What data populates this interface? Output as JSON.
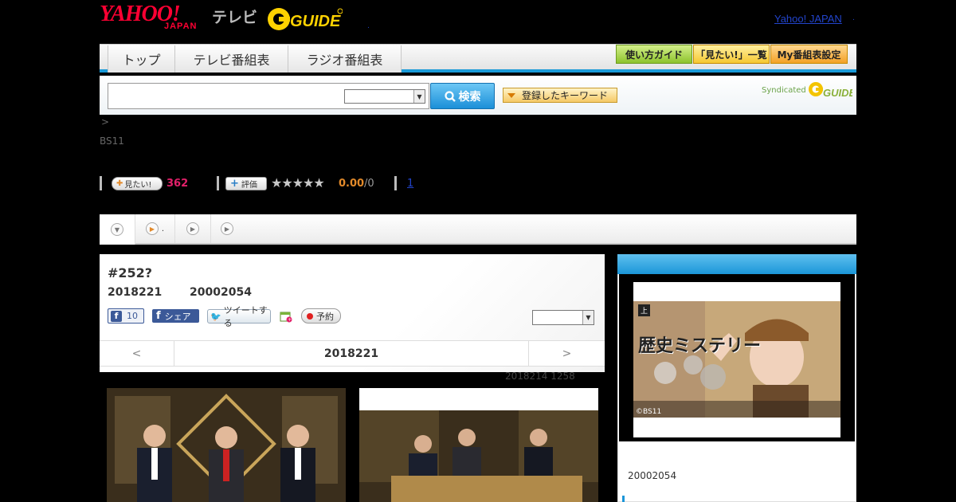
{
  "header": {
    "logo_yahoo": "YAHOO!",
    "logo_japan": "JAPAN",
    "logo_tv": "テレビ",
    "logo_gguide": "G GUIDE",
    "top_link": "Yahoo! JAPAN"
  },
  "nav": {
    "tabs": [
      "トップ",
      "テレビ番組表",
      "ラジオ番組表"
    ],
    "guide_buttons": [
      "使い方ガイド",
      "「見たい!」一覧",
      "My番組表設定"
    ]
  },
  "search": {
    "input_value": "",
    "select_value": "",
    "button_label": "検索",
    "keyword_button": "登録したキーワード",
    "syndicated": "Syndicated"
  },
  "breadcrumb": ">",
  "channel": "BS11",
  "stats": {
    "want_label": "見たい!",
    "want_count": "362",
    "rate_label": "評価",
    "rating": "0.00",
    "rating_count": "/0",
    "link": "1"
  },
  "subtabs": {
    "tab2": "."
  },
  "program": {
    "title": "#252?",
    "date": "2018221",
    "time": "20002054",
    "fb_count": "10",
    "share_label": "シェア",
    "tweet_label": "ツイートする",
    "reserve_label": "予約",
    "nav_prev": "<",
    "nav_current": "2018221",
    "nav_next": ">",
    "updated": "2018214  1258"
  },
  "side": {
    "poster_title": "歴史ミステリー",
    "poster_subtitle": "上",
    "poster_credit": "©BS11",
    "time": "20002054"
  },
  "colors": {
    "accent_blue": "#1b96d8",
    "want_pink": "#e3206a",
    "rating_orange": "#e38a2a"
  }
}
